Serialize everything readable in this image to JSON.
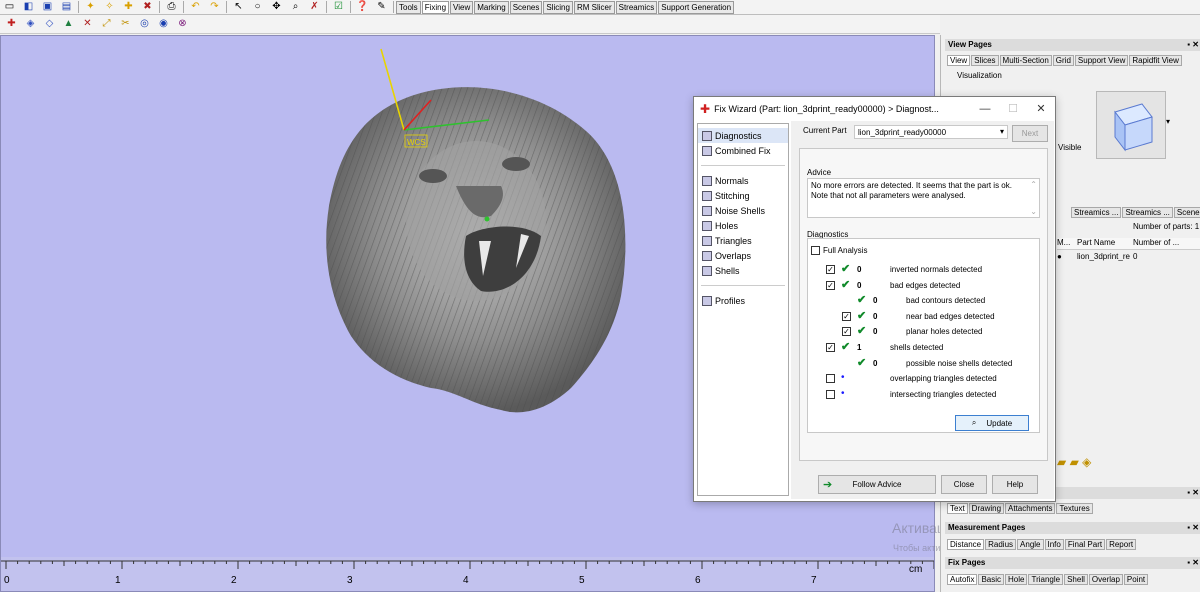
{
  "toolbar": {
    "tabs": [
      "Tools",
      "Fixing",
      "View",
      "Marking",
      "Scenes",
      "Slicing",
      "RM Slicer",
      "Streamics",
      "Support Generation"
    ],
    "active_tab": "Fixing"
  },
  "viewport": {
    "wcs_label": "WCS",
    "ruler": [
      "0",
      "1",
      "2",
      "3",
      "4",
      "5",
      "6",
      "7"
    ],
    "ruler_unit": "cm",
    "background_color": "#babaf0",
    "watermark_1": "Активация Windows",
    "watermark_2": "Чтобы активировать Windows, перейдите в раздел \"Парамет..."
  },
  "dialog": {
    "title": "Fix Wizard (Part: lion_3dprint_ready00000) > Diagnost...",
    "nav_top": [
      "Diagnostics",
      "Combined Fix"
    ],
    "nav_mid": [
      "Normals",
      "Stitching",
      "Noise Shells",
      "Holes",
      "Triangles",
      "Overlaps",
      "Shells"
    ],
    "nav_bottom": [
      "Profiles"
    ],
    "current_part_label": "Current Part",
    "current_part_value": "lion_3dprint_ready00000",
    "next_button": "Next",
    "advice_heading": "Advice",
    "advice_text": "No more errors are detected. It seems that the part is ok. Note that not all parameters were analysed.",
    "diagnostics_heading": "Diagnostics",
    "full_analysis": "Full Analysis",
    "rows": [
      {
        "label": "inverted normals detected",
        "count": "0",
        "checked": true,
        "indent": 0,
        "ok": true
      },
      {
        "label": "bad edges detected",
        "count": "0",
        "checked": true,
        "indent": 0,
        "ok": true
      },
      {
        "label": "bad contours detected",
        "count": "0",
        "checked": null,
        "indent": 1,
        "ok": true
      },
      {
        "label": "near bad edges detected",
        "count": "0",
        "checked": true,
        "indent": 1,
        "ok": true
      },
      {
        "label": "planar holes detected",
        "count": "0",
        "checked": true,
        "indent": 1,
        "ok": true
      },
      {
        "label": "shells detected",
        "count": "1",
        "checked": true,
        "indent": 0,
        "ok": true
      },
      {
        "label": "possible noise shells detected",
        "count": "0",
        "checked": null,
        "indent": 1,
        "ok": true
      },
      {
        "label": "overlapping triangles detected",
        "count": "",
        "checked": false,
        "indent": 0,
        "ok": false
      },
      {
        "label": "intersecting triangles detected",
        "count": "",
        "checked": false,
        "indent": 0,
        "ok": false
      }
    ],
    "update_button": "Update",
    "follow_advice_button": "Follow Advice",
    "close_button": "Close",
    "help_button": "Help"
  },
  "right_panel": {
    "view_pages_title": "View Pages",
    "view_tabs": [
      "View",
      "Slices",
      "Multi-Section",
      "Grid",
      "Support View",
      "Rapidfit View"
    ],
    "visualization_label": "Visualization",
    "visible_label": "Visible",
    "streamics_tabs": [
      "Streamics ...",
      "Streamics ...",
      "Scenes"
    ],
    "number_of_parts_label": "Number of parts: 1",
    "parts_table_headers": [
      "M...",
      "Part Name",
      "Number of ..."
    ],
    "parts_table_row": [
      "",
      "lion_3dprint_re",
      "0"
    ],
    "text_tabs": [
      "Text",
      "Drawing",
      "Attachments",
      "Textures"
    ],
    "measurement_title": "Measurement Pages",
    "measurement_tabs": [
      "Distance",
      "Radius",
      "Angle",
      "Info",
      "Final Part",
      "Report"
    ],
    "fix_pages_title": "Fix Pages",
    "fix_tabs": [
      "Autofix",
      "Basic",
      "Hole",
      "Triangle",
      "Shell",
      "Overlap",
      "Point"
    ]
  }
}
